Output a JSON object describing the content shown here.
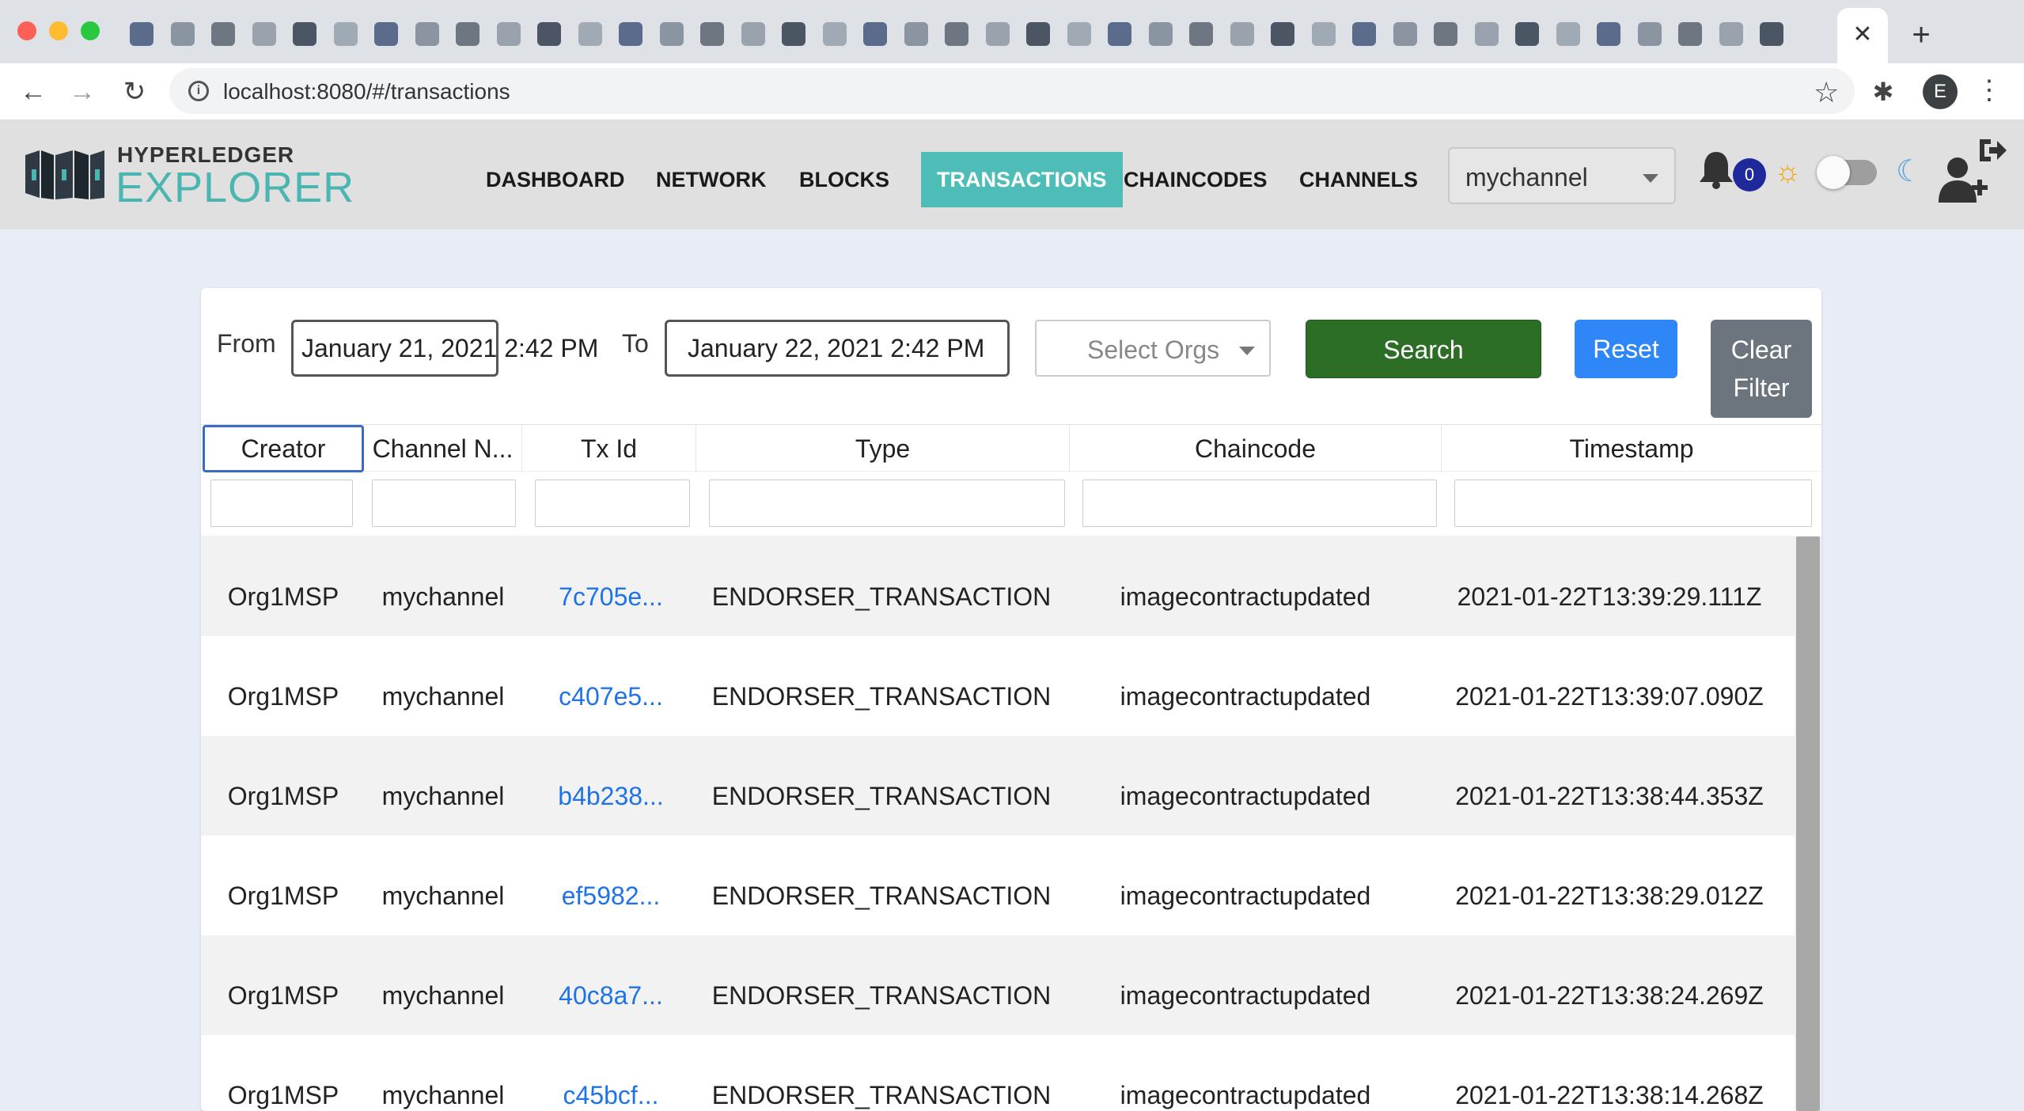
{
  "browser": {
    "url": "localhost:8080/#/transactions",
    "profile_initial": "E",
    "tab_close": "✕",
    "new_tab": "+"
  },
  "app": {
    "logo_top": "HYPERLEDGER",
    "logo_bottom": "EXPLORER",
    "nav": {
      "dashboard": "DASHBOARD",
      "network": "NETWORK",
      "blocks": "BLOCKS",
      "transactions": "TRANSACTIONS",
      "chaincodes": "CHAINCODES",
      "channels": "CHANNELS"
    },
    "channel": "mychannel",
    "notifications": "0",
    "colors": {
      "accent": "#4fbdb7",
      "search": "#2c6e26",
      "reset": "#2f86f6",
      "clear": "#6c757d",
      "link": "#1e73e8"
    }
  },
  "filters": {
    "from_label": "From",
    "from_value": "January 21, 2021 2:42 PM",
    "to_label": "To",
    "to_value": "January 22, 2021 2:42 PM",
    "orgs_placeholder": "Select Orgs",
    "search_label": "Search",
    "reset_label": "Reset",
    "clear_label_1": "Clear",
    "clear_label_2": "Filter"
  },
  "table": {
    "columns": [
      "Creator",
      "Channel N...",
      "Tx Id",
      "Type",
      "Chaincode",
      "Timestamp"
    ],
    "rows": [
      [
        "Org1MSP",
        "mychannel",
        "7c705e...",
        "ENDORSER_TRANSACTION",
        "imagecontractupdated",
        "2021-01-22T13:39:29.111Z"
      ],
      [
        "Org1MSP",
        "mychannel",
        "c407e5...",
        "ENDORSER_TRANSACTION",
        "imagecontractupdated",
        "2021-01-22T13:39:07.090Z"
      ],
      [
        "Org1MSP",
        "mychannel",
        "b4b238...",
        "ENDORSER_TRANSACTION",
        "imagecontractupdated",
        "2021-01-22T13:38:44.353Z"
      ],
      [
        "Org1MSP",
        "mychannel",
        "ef5982...",
        "ENDORSER_TRANSACTION",
        "imagecontractupdated",
        "2021-01-22T13:38:29.012Z"
      ],
      [
        "Org1MSP",
        "mychannel",
        "40c8a7...",
        "ENDORSER_TRANSACTION",
        "imagecontractupdated",
        "2021-01-22T13:38:24.269Z"
      ],
      [
        "Org1MSP",
        "mychannel",
        "c45bcf...",
        "ENDORSER_TRANSACTION",
        "imagecontractupdated",
        "2021-01-22T13:38:14.268Z"
      ]
    ]
  }
}
